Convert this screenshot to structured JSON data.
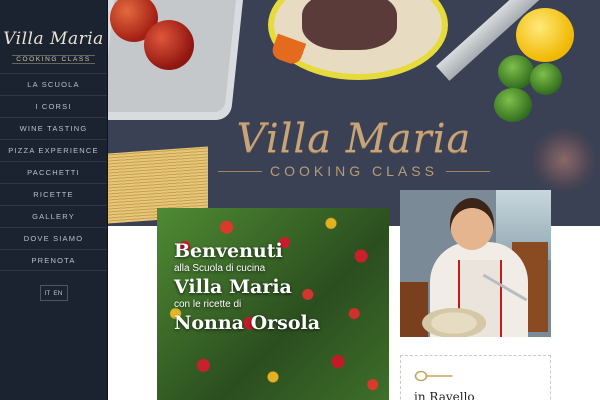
{
  "sidebar": {
    "logo_main": "Villa Maria",
    "logo_sub": "COOKING CLASS",
    "items": [
      {
        "label": "LA SCUOLA"
      },
      {
        "label": "I CORSI"
      },
      {
        "label": "WINE TASTING"
      },
      {
        "label": "PIZZA EXPERIENCE"
      },
      {
        "label": "PACCHETTI"
      },
      {
        "label": "RICETTE"
      },
      {
        "label": "GALLERY"
      },
      {
        "label": "DOVE SIAMO"
      },
      {
        "label": "PRENOTA"
      }
    ],
    "lang": [
      "IT",
      "EN"
    ]
  },
  "hero": {
    "title": "Villa Maria",
    "subtitle": "COOKING CLASS"
  },
  "welcome": {
    "line1": "Benvenuti",
    "line2": "alla Scuola di cucina",
    "line3": "Villa Maria",
    "line4": "con le ricette di",
    "line5": "Nonna Orsola"
  },
  "card": {
    "icon": "wooden-spoon-icon",
    "title": "in Ravello"
  },
  "colors": {
    "sidebar_bg": "#1b2330",
    "hero_bg": "#3a4154",
    "gold": "#c7a47a"
  }
}
